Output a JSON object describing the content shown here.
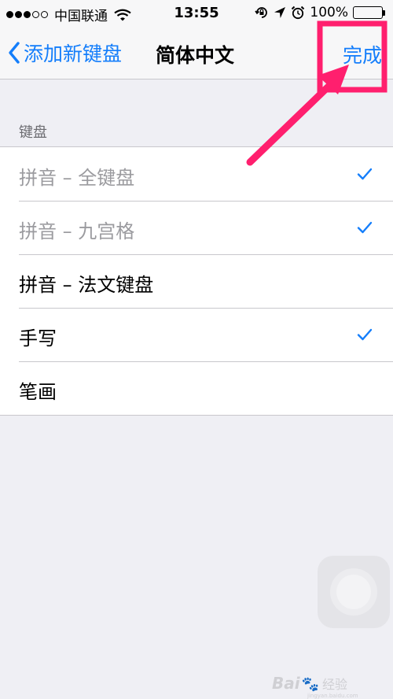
{
  "status_bar": {
    "carrier": "中国联通",
    "time": "13:55",
    "battery_text": "100%",
    "signal_bars_filled": 3,
    "signal_bars_total": 5
  },
  "nav": {
    "back_label": "添加新键盘",
    "title": "简体中文",
    "done_label": "完成"
  },
  "section": {
    "header": "键盘",
    "rows": [
      {
        "label": "拼音 – 全键盘",
        "checked": true,
        "muted": true
      },
      {
        "label": "拼音 – 九宫格",
        "checked": true,
        "muted": true
      },
      {
        "label": "拼音 – 法文键盘",
        "checked": false,
        "muted": false
      },
      {
        "label": "手写",
        "checked": true,
        "muted": false
      },
      {
        "label": "笔画",
        "checked": false,
        "muted": false
      }
    ]
  },
  "watermark": {
    "brand": "Bai",
    "brand_suffix": "经验",
    "url": "jingyan.baidu.com"
  },
  "colors": {
    "accent": "#147efb",
    "annotation": "#ff1f6e",
    "background": "#efeff4"
  },
  "icons": {
    "back": "chevron-left-icon",
    "check": "checkmark-icon",
    "wifi": "wifi-icon",
    "rotation_lock": "rotation-lock-icon",
    "location": "location-arrow-icon",
    "alarm": "alarm-icon",
    "battery": "battery-icon"
  }
}
